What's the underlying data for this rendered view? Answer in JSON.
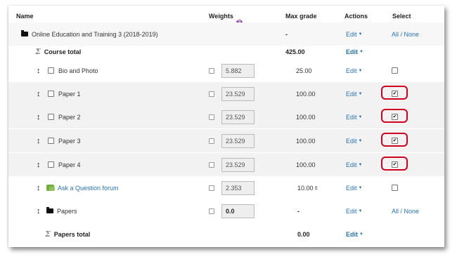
{
  "header": {
    "name": "Name",
    "weights": "Weights",
    "max_grade": "Max grade",
    "actions": "Actions",
    "select": "Select"
  },
  "icons": {
    "weights_help": "question-circle-icon",
    "move": "move-arrows-icon",
    "folder": "folder-icon",
    "sigma": "sigma-icon",
    "forum": "forum-icon"
  },
  "colors": {
    "link": "#2573b5",
    "highlight_ring": "#d2001f",
    "help_icon": "#8e44ad"
  },
  "category": {
    "name": "Online Education and Training 3 (2018-2019)",
    "max": "-",
    "edit": "Edit",
    "select": "All / None"
  },
  "course_total": {
    "name": "Course total",
    "max": "425.00",
    "edit": "Edit"
  },
  "items": [
    {
      "name": "Bio and Photo",
      "weight": "5.882",
      "max": "25.00",
      "edit": "Edit",
      "checked": false
    },
    {
      "name": "Paper 1",
      "weight": "23.529",
      "max": "100.00",
      "edit": "Edit",
      "checked": true
    },
    {
      "name": "Paper 2",
      "weight": "23.529",
      "max": "100.00",
      "edit": "Edit",
      "checked": true
    },
    {
      "name": "Paper 3",
      "weight": "23.529",
      "max": "100.00",
      "edit": "Edit",
      "checked": true
    },
    {
      "name": "Paper 4",
      "weight": "23.529",
      "max": "100.00",
      "edit": "Edit",
      "checked": true
    }
  ],
  "forum": {
    "name": "Ask a Question forum",
    "weight": "2.353",
    "max": "10.00",
    "max_suffix": "±",
    "edit": "Edit"
  },
  "papers": {
    "name": "Papers",
    "weight": "0.0",
    "max": "-",
    "edit": "Edit",
    "select": "All / None"
  },
  "papers_total": {
    "name": "Papers total",
    "max": "0.00",
    "edit": "Edit"
  },
  "edit_caret": "▼",
  "check_mark": "✔"
}
